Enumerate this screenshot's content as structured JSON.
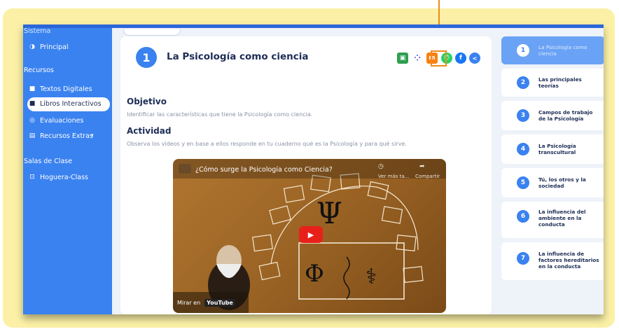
{
  "sidebar": {
    "top_cut": "Sistema",
    "items": [
      {
        "label": "Principal",
        "icon": "dashboard-icon"
      },
      {
        "label": "Recursos",
        "heading": true
      },
      {
        "label": "Textos Digitales",
        "icon": "book-icon"
      },
      {
        "label": "Libros Interactivos",
        "icon": "book-icon",
        "active": true
      },
      {
        "label": "Evaluaciones",
        "icon": "target-icon"
      },
      {
        "label": "Recursos Extras",
        "icon": "file-icon",
        "dropdown": true
      },
      {
        "label": "Salas de Clase",
        "heading": true
      },
      {
        "label": "Hoguera-Class",
        "icon": "presentation-icon"
      }
    ]
  },
  "lesson": {
    "number": "1",
    "title": "La Psicología como ciencia",
    "objective_heading": "Objetivo",
    "objective_text": "Identificar las características que tiene la Psicología como ciencia.",
    "activity_heading": "Actividad",
    "activity_text": "Observa los videos y en base a ellos responde en tu cuaderno qué es la Psicología y para qué sirve."
  },
  "share_icons": [
    {
      "name": "google-classroom-icon",
      "color": "#2e9e4f",
      "glyph": "▣"
    },
    {
      "name": "teams-icon",
      "color": "#5b5fc7",
      "glyph": "⁘"
    },
    {
      "name": "moodle-icon",
      "color": "#f98012",
      "glyph": "m"
    },
    {
      "name": "whatsapp-icon",
      "color": "#25d366",
      "glyph": "✆"
    },
    {
      "name": "facebook-icon",
      "color": "#1877f2",
      "glyph": "f"
    },
    {
      "name": "share-icon",
      "color": "#3a82f0",
      "glyph": "<"
    }
  ],
  "video": {
    "title": "¿Cómo surge la Psicología como Ciencia?",
    "watch_later": "Ver más ta...",
    "share": "Compartir",
    "watch_on": "Mirar en",
    "youtube": "YouTube"
  },
  "steps": [
    {
      "num": "1",
      "label": "La Psicología como ciencia",
      "active": true
    },
    {
      "num": "2",
      "label": "Las principales teorías"
    },
    {
      "num": "3",
      "label": "Campos de trabajo de la Psicología"
    },
    {
      "num": "4",
      "label": "La Psicología transcultural"
    },
    {
      "num": "5",
      "label": "Tú, los otros y la sociedad"
    },
    {
      "num": "6",
      "label": "La influencia del ambiente en la conducta"
    },
    {
      "num": "7",
      "label": "La influencia de factores hereditarios en la conducta"
    }
  ],
  "colors": {
    "frame": "#fbf0a6",
    "sidebar": "#3a82f0",
    "highlight": "#f08a1c",
    "title": "#1d2d56"
  }
}
